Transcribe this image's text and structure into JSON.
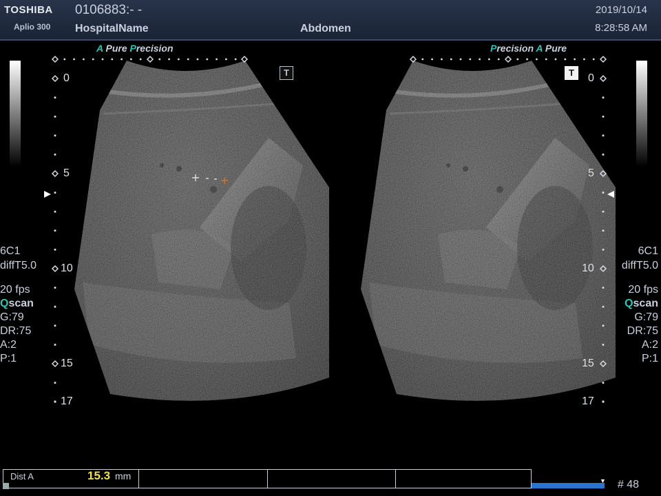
{
  "header": {
    "brand": "TOSHIBA",
    "model": "Aplio 300",
    "patient_id": "0106883:- -",
    "hospital": "HospitalName",
    "exam": "Abdomen",
    "date": "2019/10/14",
    "time": "8:28:58 AM"
  },
  "brand_tags": {
    "left": {
      "a1": "A",
      "pure": " Pure ",
      "p1": "P",
      "precision": "recision"
    },
    "right": {
      "p1": "P",
      "precision": "recision ",
      "a1": "A",
      "pure": " Pure"
    }
  },
  "depth_scale": {
    "left": {
      "d0": "0",
      "d5": "5",
      "d10": "10",
      "d15": "15",
      "d17": "17"
    },
    "right": {
      "d0": "0",
      "d5": "5",
      "d10": "10",
      "d15": "15",
      "d17": "17"
    }
  },
  "params": {
    "probe": "6C1",
    "mode": "diffT5.0",
    "fps": "20 fps",
    "qscan_q": "Q",
    "qscan_rest": "scan",
    "gain": "G:79",
    "dynamic_range": "DR:75",
    "a": "A:2",
    "p": "P:1"
  },
  "t_icon": "T",
  "measurement": {
    "label": "Dist A",
    "value": "15.3",
    "unit": "mm"
  },
  "frame": "# 48",
  "colors": {
    "accent": "#2fc2b6",
    "value": "#f3e04a",
    "cine": "#2a73d0",
    "caliper": "#e87a1e"
  },
  "icons": {
    "orientation_left": "triangle-right-icon",
    "orientation_right": "triangle-left-icon",
    "caliper": "plus-icon"
  }
}
